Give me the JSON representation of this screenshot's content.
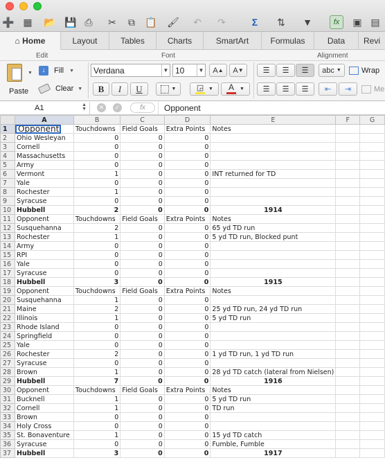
{
  "toolbar": {
    "icons": [
      "new-icon",
      "gallery-icon",
      "open-icon",
      "save-icon",
      "print-icon",
      "cut-icon",
      "copy-icon",
      "paste-icon",
      "format-painter-icon",
      "undo-icon",
      "redo-icon",
      "autosum-icon",
      "sort-icon",
      "filter-icon",
      "formula-builder-icon",
      "gallery-view-icon",
      "toolbox-icon"
    ]
  },
  "tabs": [
    "Home",
    "Layout",
    "Tables",
    "Charts",
    "SmartArt",
    "Formulas",
    "Data",
    "Revi"
  ],
  "ribbon": {
    "edit_label": "Edit",
    "font_label": "Font",
    "alignment_label": "Alignment",
    "paste_label": "Paste",
    "fill_label": "Fill",
    "clear_label": "Clear",
    "font_name": "Verdana",
    "font_size": "10",
    "bold": "B",
    "italic": "I",
    "underline": "U",
    "wrap_label": "Wrap",
    "abc_label": "abc",
    "merge_label": "Me",
    "highlight_color": "#f5e63c",
    "font_color": "#d0312d"
  },
  "formula_bar": {
    "cell_ref": "A1",
    "fx": "fx",
    "content": "Opponent"
  },
  "columns": [
    "A",
    "B",
    "C",
    "D",
    "E",
    "F",
    "G"
  ],
  "rows": [
    {
      "n": "1",
      "a": "Opponent",
      "b": "Touchdowns",
      "c": "Field Goals",
      "d": "Extra Points",
      "e": "Notes",
      "bold": false,
      "hdr": true
    },
    {
      "n": "2",
      "a": "Ohio Wesleyan",
      "b": "0",
      "c": "0",
      "d": "0",
      "e": ""
    },
    {
      "n": "3",
      "a": "Cornell",
      "b": "0",
      "c": "0",
      "d": "0",
      "e": ""
    },
    {
      "n": "4",
      "a": "Massachusetts",
      "b": "0",
      "c": "0",
      "d": "0",
      "e": ""
    },
    {
      "n": "5",
      "a": "Army",
      "b": "0",
      "c": "0",
      "d": "0",
      "e": ""
    },
    {
      "n": "6",
      "a": "Vermont",
      "b": "1",
      "c": "0",
      "d": "0",
      "e": "INT returned for TD"
    },
    {
      "n": "7",
      "a": "Yale",
      "b": "0",
      "c": "0",
      "d": "0",
      "e": ""
    },
    {
      "n": "8",
      "a": "Rochester",
      "b": "1",
      "c": "0",
      "d": "0",
      "e": ""
    },
    {
      "n": "9",
      "a": "Syracuse",
      "b": "0",
      "c": "0",
      "d": "0",
      "e": ""
    },
    {
      "n": "10",
      "a": "Hubbell",
      "b": "2",
      "c": "0",
      "d": "0",
      "e": "1914",
      "bold": true
    },
    {
      "n": "11",
      "a": "Opponent",
      "b": "Touchdowns",
      "c": "Field Goals",
      "d": "Extra Points",
      "e": "Notes",
      "hdr": true
    },
    {
      "n": "12",
      "a": "Susquehanna",
      "b": "2",
      "c": "0",
      "d": "0",
      "e": "65 yd TD run"
    },
    {
      "n": "13",
      "a": "Rochester",
      "b": "1",
      "c": "0",
      "d": "0",
      "e": "5 yd TD run, Blocked punt"
    },
    {
      "n": "14",
      "a": "Army",
      "b": "0",
      "c": "0",
      "d": "0",
      "e": ""
    },
    {
      "n": "15",
      "a": "RPI",
      "b": "0",
      "c": "0",
      "d": "0",
      "e": ""
    },
    {
      "n": "16",
      "a": "Yale",
      "b": "0",
      "c": "0",
      "d": "0",
      "e": ""
    },
    {
      "n": "17",
      "a": "Syracuse",
      "b": "0",
      "c": "0",
      "d": "0",
      "e": ""
    },
    {
      "n": "18",
      "a": "Hubbell",
      "b": "3",
      "c": "0",
      "d": "0",
      "e": "1915",
      "bold": true
    },
    {
      "n": "19",
      "a": "Opponent",
      "b": "Touchdowns",
      "c": "Field Goals",
      "d": "Extra Points",
      "e": "Notes",
      "hdr": true
    },
    {
      "n": "20",
      "a": "Susquehanna",
      "b": "1",
      "c": "0",
      "d": "0",
      "e": ""
    },
    {
      "n": "21",
      "a": "Maine",
      "b": "2",
      "c": "0",
      "d": "0",
      "e": "25 yd TD run, 24 yd TD run"
    },
    {
      "n": "22",
      "a": "Illinois",
      "b": "1",
      "c": "0",
      "d": "0",
      "e": "5 yd TD run"
    },
    {
      "n": "23",
      "a": "Rhode Island",
      "b": "0",
      "c": "0",
      "d": "0",
      "e": ""
    },
    {
      "n": "24",
      "a": "Springfield",
      "b": "0",
      "c": "0",
      "d": "0",
      "e": ""
    },
    {
      "n": "25",
      "a": "Yale",
      "b": "0",
      "c": "0",
      "d": "0",
      "e": ""
    },
    {
      "n": "26",
      "a": "Rochester",
      "b": "2",
      "c": "0",
      "d": "0",
      "e": "1 yd TD run, 1 yd TD run"
    },
    {
      "n": "27",
      "a": "Syracuse",
      "b": "0",
      "c": "0",
      "d": "0",
      "e": ""
    },
    {
      "n": "28",
      "a": "Brown",
      "b": "1",
      "c": "0",
      "d": "0",
      "e": "28 yd TD catch (lateral from Nielsen)"
    },
    {
      "n": "29",
      "a": "Hubbell",
      "b": "7",
      "c": "0",
      "d": "0",
      "e": "1916",
      "bold": true
    },
    {
      "n": "30",
      "a": "Opponent",
      "b": "Touchdowns",
      "c": "Field Goals",
      "d": "Extra Points",
      "e": "Notes",
      "hdr": true
    },
    {
      "n": "31",
      "a": "Bucknell",
      "b": "1",
      "c": "0",
      "d": "0",
      "e": "5 yd TD run"
    },
    {
      "n": "32",
      "a": "Cornell",
      "b": "1",
      "c": "0",
      "d": "0",
      "e": "TD run"
    },
    {
      "n": "33",
      "a": "Brown",
      "b": "0",
      "c": "0",
      "d": "0",
      "e": ""
    },
    {
      "n": "34",
      "a": "Holy Cross",
      "b": "0",
      "c": "0",
      "d": "0",
      "e": ""
    },
    {
      "n": "35",
      "a": "St. Bonaventure",
      "b": "1",
      "c": "0",
      "d": "0",
      "e": "15 yd TD catch"
    },
    {
      "n": "36",
      "a": "Syracuse",
      "b": "0",
      "c": "0",
      "d": "0",
      "e": "Fumble, Fumble"
    },
    {
      "n": "37",
      "a": "Hubbell",
      "b": "3",
      "c": "0",
      "d": "0",
      "e": "1917",
      "bold": true
    }
  ]
}
